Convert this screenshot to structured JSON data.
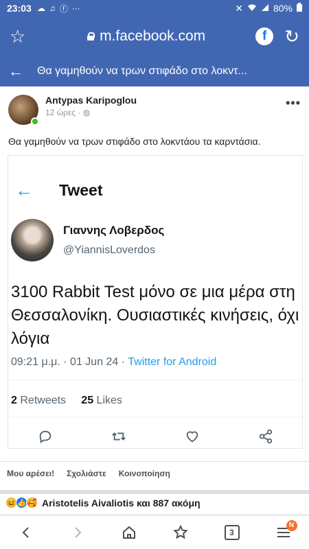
{
  "status_bar": {
    "time": "23:03",
    "battery": "80%",
    "icons": [
      "cloud-icon",
      "music-icon",
      "facebook-icon",
      "more-icon",
      "mute-icon",
      "wifi-icon",
      "signal-icon",
      "battery-icon"
    ]
  },
  "browser": {
    "url": "m.facebook.com",
    "fb_badge": "f"
  },
  "page_header": {
    "title": "Θα γαμηθούν να τρων στιφάδο στο λοκντ..."
  },
  "post": {
    "author": "Antypas Karipoglou",
    "time": "12 ώρες",
    "text": "Θα γαμηθούν να τρων στιφάδο στο λοκντάου τα καρντάσια."
  },
  "tweet": {
    "header_title": "Tweet",
    "author_name": "Γιαννης Λοβερδος",
    "handle": "@YiannisLoverdos",
    "text": "3100 Rabbit Test μόνο σε μια μέρα στη Θεσσαλονίκη. Ουσιαστικές κινήσεις, όχι λόγια",
    "time": "09:21 μ.μ.",
    "date": "01 Jun 24",
    "source": "Twitter for Android",
    "retweets_count": "2",
    "retweets_label": "Retweets",
    "likes_count": "25",
    "likes_label": "Likes"
  },
  "post_actions": {
    "like": "Μου αρέσει!",
    "comment": "Σχολιάστε",
    "share": "Κοινοποίηση"
  },
  "reactions": {
    "summary": "Aristotelis Aivaliotis και 887 ακόμη"
  },
  "bottom_nav": {
    "tabs_count": "3",
    "menu_badge": "N"
  },
  "colors": {
    "facebook_blue": "#4267b2",
    "twitter_blue": "#1d9bf0",
    "online_green": "#42b72a"
  }
}
